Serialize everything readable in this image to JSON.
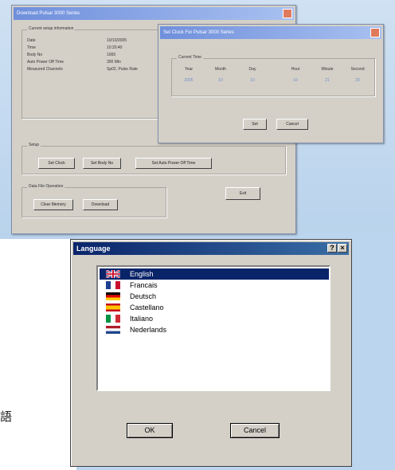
{
  "download_window": {
    "title": "Download Pulsar 3000 Series",
    "setup_info": {
      "label": "Current setup information",
      "rows": [
        {
          "key": "Date",
          "value": "10/10/2005"
        },
        {
          "key": "Time",
          "value": "10:20:40"
        },
        {
          "key": "Body No",
          "value": "1000"
        },
        {
          "key": "Auto Power Off Time",
          "value": "300 Min"
        },
        {
          "key": "Measured Channels",
          "value": "Sp02, Pulse Rate"
        }
      ]
    },
    "setup": {
      "label": "Setup",
      "buttons": [
        "Set Clock",
        "Set Body No",
        "Set Auto Power Off Time"
      ]
    },
    "data": {
      "label": "Data File Operation",
      "buttons": [
        "Clear Memory",
        "Download"
      ]
    },
    "exit_label": "Exit"
  },
  "clock_window": {
    "title": "Set Clock For Pulsar 3000 Series",
    "group_label": "Current Time",
    "headers": [
      "Year",
      "Month",
      "Day",
      "Hour",
      "Minute",
      "Second"
    ],
    "values": [
      "2005",
      "10",
      "10",
      "10",
      "21",
      "20"
    ],
    "ok_label": "Set",
    "cancel_label": "Cancel"
  },
  "language_dialog": {
    "title": "Language",
    "help_glyph": "?",
    "close_glyph": "×",
    "items": [
      {
        "label": "English",
        "flag": "uk-flag-icon"
      },
      {
        "label": "Francais",
        "flag": "france-flag-icon"
      },
      {
        "label": "Deutsch",
        "flag": "germany-flag-icon"
      },
      {
        "label": "Castellano",
        "flag": "spain-flag-icon"
      },
      {
        "label": "Italiano",
        "flag": "italy-flag-icon"
      },
      {
        "label": "Nederlands",
        "flag": "netherlands-flag-icon"
      }
    ],
    "selected_index": 0,
    "ok_label": "OK",
    "cancel_label": "Cancel"
  },
  "side_caption": "語"
}
